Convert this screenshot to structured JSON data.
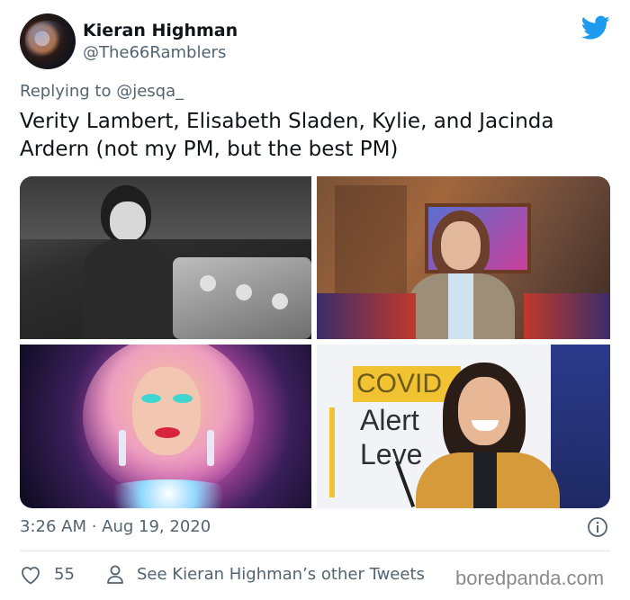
{
  "user": {
    "display_name": "Kieran Highman",
    "handle": "@The66Ramblers"
  },
  "reply": {
    "prefix": "Replying to ",
    "mention": "@jesqa_"
  },
  "tweet": {
    "text": "Verity Lambert, Elisabeth Sladen, Kylie, and Jacinda Ardern (not my PM, but the best PM)"
  },
  "photos": {
    "photo_4_sign": [
      "COVID",
      "Alert",
      "Leve"
    ]
  },
  "meta": {
    "timestamp": "3:26 AM · Aug 19, 2020"
  },
  "actions": {
    "likes": "55",
    "see_tweets": "See Kieran Highman’s other Tweets"
  },
  "watermark": "boredpanda.com",
  "colors": {
    "twitter_blue": "#1d9bf0",
    "secondary_text": "#536471",
    "primary_text": "#0f1419"
  },
  "icons": [
    "twitter-bird-icon",
    "info-icon",
    "heart-icon",
    "user-icon"
  ]
}
